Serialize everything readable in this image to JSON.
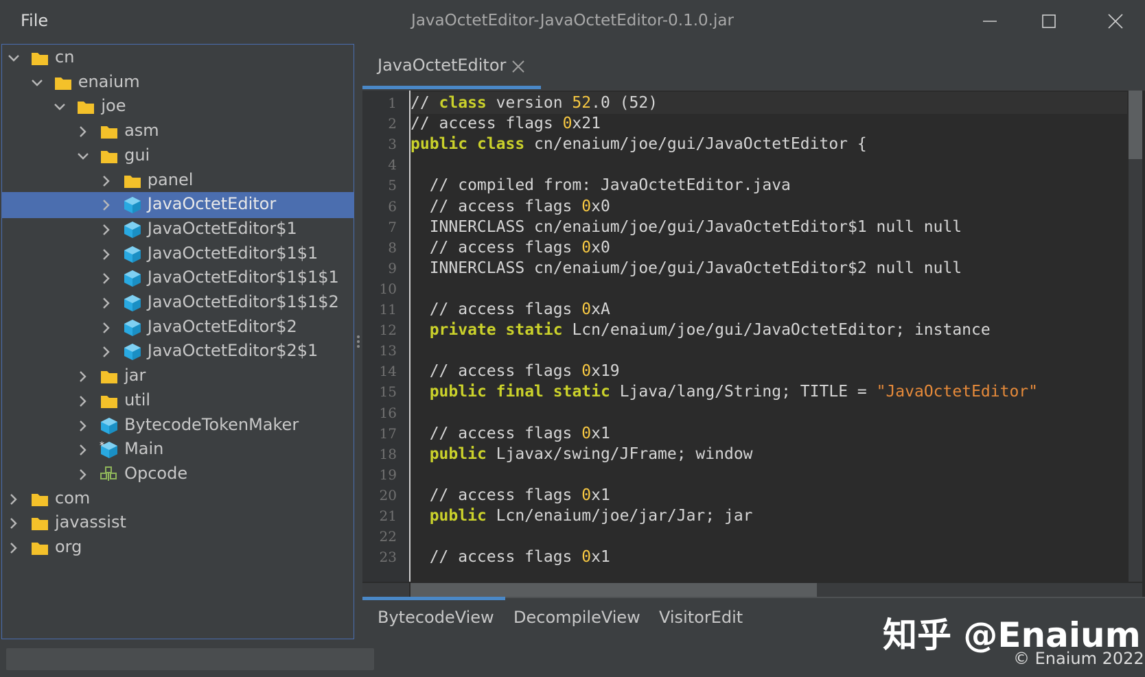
{
  "window": {
    "title": "JavaOctetEditor-JavaOctetEditor-0.1.0.jar",
    "menu_file": "File"
  },
  "tree": [
    {
      "label": "cn",
      "depth": 0,
      "icon": "folder-icon",
      "expanded": true
    },
    {
      "label": "enaium",
      "depth": 1,
      "icon": "folder-icon",
      "expanded": true
    },
    {
      "label": "joe",
      "depth": 2,
      "icon": "folder-icon",
      "expanded": true
    },
    {
      "label": "asm",
      "depth": 3,
      "icon": "folder-icon",
      "expanded": false
    },
    {
      "label": "gui",
      "depth": 3,
      "icon": "folder-icon",
      "expanded": true
    },
    {
      "label": "panel",
      "depth": 4,
      "icon": "folder-icon",
      "expanded": false
    },
    {
      "label": "JavaOctetEditor",
      "depth": 4,
      "icon": "class-icon",
      "expanded": false,
      "selected": true
    },
    {
      "label": "JavaOctetEditor$1",
      "depth": 4,
      "icon": "class-icon",
      "expanded": false
    },
    {
      "label": "JavaOctetEditor$1$1",
      "depth": 4,
      "icon": "class-icon",
      "expanded": false
    },
    {
      "label": "JavaOctetEditor$1$1$1",
      "depth": 4,
      "icon": "class-icon",
      "expanded": false
    },
    {
      "label": "JavaOctetEditor$1$1$2",
      "depth": 4,
      "icon": "class-icon",
      "expanded": false
    },
    {
      "label": "JavaOctetEditor$2",
      "depth": 4,
      "icon": "class-icon",
      "expanded": false
    },
    {
      "label": "JavaOctetEditor$2$1",
      "depth": 4,
      "icon": "class-icon",
      "expanded": false
    },
    {
      "label": "jar",
      "depth": 3,
      "icon": "folder-icon",
      "expanded": false
    },
    {
      "label": "util",
      "depth": 3,
      "icon": "folder-icon",
      "expanded": false
    },
    {
      "label": "BytecodeTokenMaker",
      "depth": 3,
      "icon": "class-icon",
      "expanded": false
    },
    {
      "label": "Main",
      "depth": 3,
      "icon": "main-class-icon",
      "expanded": false
    },
    {
      "label": "Opcode",
      "depth": 3,
      "icon": "enum-icon",
      "expanded": false
    },
    {
      "label": "com",
      "depth": 0,
      "icon": "folder-icon",
      "expanded": false
    },
    {
      "label": "javassist",
      "depth": 0,
      "icon": "folder-icon",
      "expanded": false
    },
    {
      "label": "org",
      "depth": 0,
      "icon": "folder-icon",
      "expanded": false
    }
  ],
  "editor": {
    "tab_label": "JavaOctetEditor",
    "lines": [
      [
        [
          "c",
          "// "
        ],
        [
          "k",
          "class"
        ],
        [
          "c",
          " version "
        ],
        [
          "n",
          "52"
        ],
        [
          "c",
          ".0 (52)"
        ]
      ],
      [
        [
          "c",
          "// access flags "
        ],
        [
          "n",
          "0"
        ],
        [
          "c",
          "x21"
        ]
      ],
      [
        [
          "k",
          "public"
        ],
        [
          "c",
          " "
        ],
        [
          "k",
          "class"
        ],
        [
          "c",
          " cn/enaium/joe/gui/JavaOctetEditor {"
        ]
      ],
      [
        [
          "c",
          ""
        ]
      ],
      [
        [
          "c",
          "  // compiled from: JavaOctetEditor.java"
        ]
      ],
      [
        [
          "c",
          "  // access flags "
        ],
        [
          "n",
          "0"
        ],
        [
          "c",
          "x0"
        ]
      ],
      [
        [
          "c",
          "  INNERCLASS cn/enaium/joe/gui/JavaOctetEditor$1 null null"
        ]
      ],
      [
        [
          "c",
          "  // access flags "
        ],
        [
          "n",
          "0"
        ],
        [
          "c",
          "x0"
        ]
      ],
      [
        [
          "c",
          "  INNERCLASS cn/enaium/joe/gui/JavaOctetEditor$2 null null"
        ]
      ],
      [
        [
          "c",
          ""
        ]
      ],
      [
        [
          "c",
          "  // access flags "
        ],
        [
          "n",
          "0"
        ],
        [
          "c",
          "xA"
        ]
      ],
      [
        [
          "c",
          "  "
        ],
        [
          "k",
          "private"
        ],
        [
          "c",
          " "
        ],
        [
          "k",
          "static"
        ],
        [
          "c",
          " Lcn/enaium/joe/gui/JavaOctetEditor; instance"
        ]
      ],
      [
        [
          "c",
          ""
        ]
      ],
      [
        [
          "c",
          "  // access flags "
        ],
        [
          "n",
          "0"
        ],
        [
          "c",
          "x19"
        ]
      ],
      [
        [
          "c",
          "  "
        ],
        [
          "k",
          "public"
        ],
        [
          "c",
          " "
        ],
        [
          "k",
          "final"
        ],
        [
          "c",
          " "
        ],
        [
          "k",
          "static"
        ],
        [
          "c",
          " Ljava/lang/String; TITLE = "
        ],
        [
          "s",
          "\"JavaOctetEditor\""
        ]
      ],
      [
        [
          "c",
          ""
        ]
      ],
      [
        [
          "c",
          "  // access flags "
        ],
        [
          "n",
          "0"
        ],
        [
          "c",
          "x1"
        ]
      ],
      [
        [
          "c",
          "  "
        ],
        [
          "k",
          "public"
        ],
        [
          "c",
          " Ljavax/swing/JFrame; window"
        ]
      ],
      [
        [
          "c",
          ""
        ]
      ],
      [
        [
          "c",
          "  // access flags "
        ],
        [
          "n",
          "0"
        ],
        [
          "c",
          "x1"
        ]
      ],
      [
        [
          "c",
          "  "
        ],
        [
          "k",
          "public"
        ],
        [
          "c",
          " Lcn/enaium/joe/jar/Jar; jar"
        ]
      ],
      [
        [
          "c",
          ""
        ]
      ],
      [
        [
          "c",
          "  // access flags "
        ],
        [
          "n",
          "0"
        ],
        [
          "c",
          "x1"
        ]
      ]
    ]
  },
  "bottom_tabs": [
    "BytecodeView",
    "DecompileView",
    "VisitorEdit"
  ],
  "watermark": "知乎 @Enaium",
  "copyright": "© Enaium 2022",
  "colors": {
    "selection": "#4b6eaf",
    "folder": "#f4c12a",
    "class": "#29a9e1",
    "keyword": "#cbd22b",
    "number": "#f7c842",
    "string": "#e68a3a",
    "accent": "#4a88c7"
  }
}
